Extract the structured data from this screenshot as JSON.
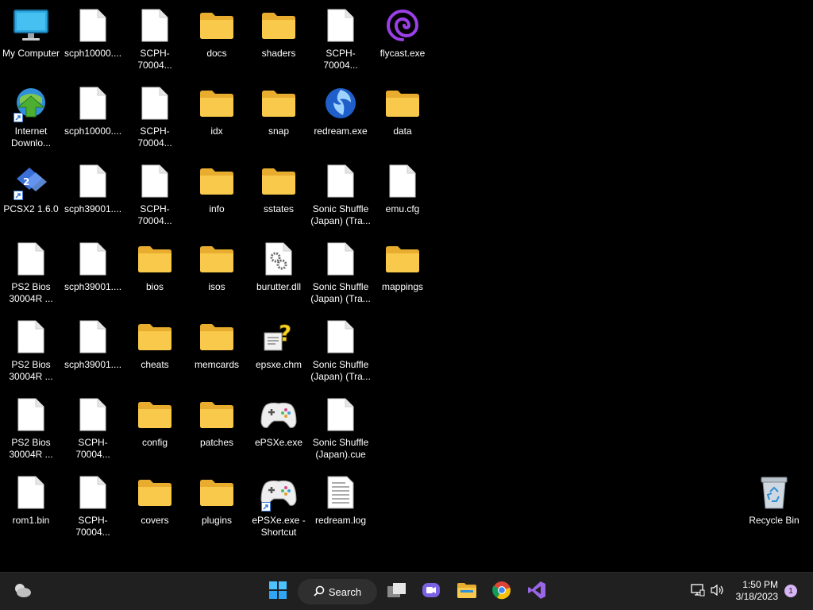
{
  "desktop": {
    "icons": [
      {
        "label": "My Computer"
      },
      {
        "label": "scph10000...."
      },
      {
        "label": "SCPH-70004..."
      },
      {
        "label": "docs"
      },
      {
        "label": "shaders"
      },
      {
        "label": "SCPH-70004..."
      },
      {
        "label": "flycast.exe"
      },
      {
        "label": "Internet Downlo..."
      },
      {
        "label": "scph10000...."
      },
      {
        "label": "SCPH-70004..."
      },
      {
        "label": "idx"
      },
      {
        "label": "snap"
      },
      {
        "label": "redream.exe"
      },
      {
        "label": "data"
      },
      {
        "label": "PCSX2 1.6.0"
      },
      {
        "label": "scph39001...."
      },
      {
        "label": "SCPH-70004..."
      },
      {
        "label": "info"
      },
      {
        "label": "sstates"
      },
      {
        "label": "Sonic Shuffle (Japan) (Tra..."
      },
      {
        "label": "emu.cfg"
      },
      {
        "label": "PS2 Bios 30004R ..."
      },
      {
        "label": "scph39001...."
      },
      {
        "label": "bios"
      },
      {
        "label": "isos"
      },
      {
        "label": "burutter.dll"
      },
      {
        "label": "Sonic Shuffle (Japan) (Tra..."
      },
      {
        "label": "mappings"
      },
      {
        "label": "PS2 Bios 30004R ..."
      },
      {
        "label": "scph39001...."
      },
      {
        "label": "cheats"
      },
      {
        "label": "memcards"
      },
      {
        "label": "epsxe.chm"
      },
      {
        "label": "Sonic Shuffle (Japan) (Tra..."
      },
      {
        "label": "PS2 Bios 30004R ..."
      },
      {
        "label": "SCPH-70004..."
      },
      {
        "label": "config"
      },
      {
        "label": "patches"
      },
      {
        "label": "ePSXe.exe"
      },
      {
        "label": "Sonic Shuffle (Japan).cue"
      },
      {
        "label": "rom1.bin"
      },
      {
        "label": "SCPH-70004..."
      },
      {
        "label": "covers"
      },
      {
        "label": "plugins"
      },
      {
        "label": "ePSXe.exe - Shortcut"
      },
      {
        "label": "redream.log"
      },
      {
        "label": "Recycle Bin"
      }
    ]
  },
  "taskbar": {
    "search_label": "Search",
    "time": "1:50 PM",
    "date": "3/18/2023",
    "notification_count": "1"
  },
  "colors": {
    "folder": "#f8c94a",
    "taskbar": "#202020",
    "accent": "#3a7bd5"
  }
}
